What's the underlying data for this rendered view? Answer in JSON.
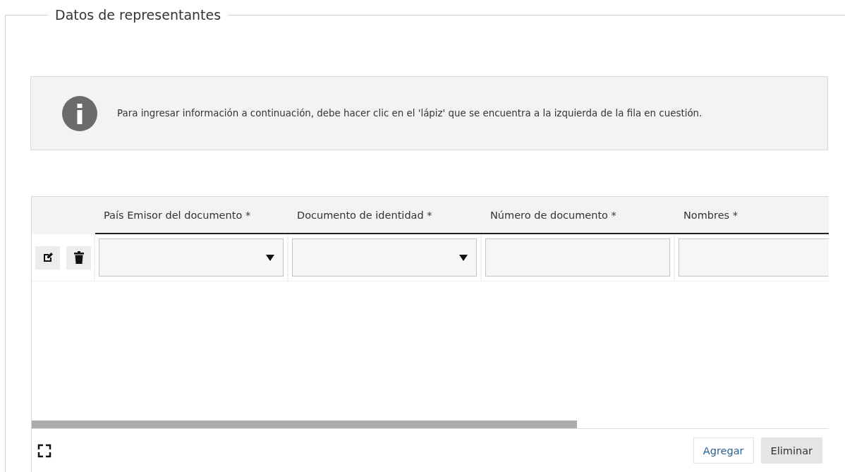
{
  "section": {
    "title": "Datos de representantes"
  },
  "info": {
    "message": "Para ingresar información a continuación, debe hacer clic en el 'lápiz' que se encuentra a la izquierda de la fila en cuestión."
  },
  "table": {
    "columns": [
      {
        "label": "País Emisor del documento *",
        "kind": "select"
      },
      {
        "label": "Documento de identidad *",
        "kind": "select"
      },
      {
        "label": "Número de documento *",
        "kind": "text"
      },
      {
        "label": "Nombres *",
        "kind": "text"
      }
    ],
    "rows": [
      {
        "editable": true
      }
    ]
  },
  "buttons": [
    {
      "label": "Agregar",
      "kind": "outline"
    },
    {
      "label": "Eliminar",
      "kind": "filled"
    }
  ]
}
